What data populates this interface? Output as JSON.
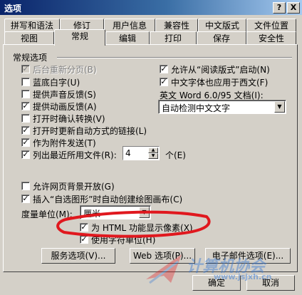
{
  "window": {
    "title": "选项",
    "help_button": "?",
    "close_button": "X"
  },
  "tabs_row1": [
    "拼写和语法",
    "修订",
    "用户信息",
    "兼容性",
    "中文版式",
    "文件位置"
  ],
  "tabs_row2": [
    "视图",
    "常规",
    "编辑",
    "打印",
    "保存",
    "安全性"
  ],
  "active_tab": "常规",
  "group_title": "常规选项",
  "left_options": [
    {
      "label": "后台重新分页(B)",
      "checked": true,
      "disabled": true
    },
    {
      "label": "蓝底白字(U)",
      "checked": false,
      "disabled": false
    },
    {
      "label": "提供声音反馈(S)",
      "checked": false,
      "disabled": false
    },
    {
      "label": "提供动画反馈(A)",
      "checked": true,
      "disabled": false
    },
    {
      "label": "打开时确认转换(V)",
      "checked": false,
      "disabled": false
    },
    {
      "label": "打开时更新自动方式的链接(L)",
      "checked": true,
      "disabled": false
    },
    {
      "label": "作为附件发送(T)",
      "checked": true,
      "disabled": false
    },
    {
      "label": "列出最近所用文件(R):",
      "checked": true,
      "disabled": false
    }
  ],
  "recent_files": {
    "value": "4",
    "suffix": "个(E)"
  },
  "right_options": [
    {
      "label": "允许从“阅读版式”启动(N)",
      "checked": true
    },
    {
      "label": "中文字体也应用于西文(F)",
      "checked": true
    }
  ],
  "english_word_label": "英文 Word 6.0/95 文档(I):",
  "english_word_value": "自动检测中文文字",
  "lower_options": [
    {
      "label": "允许网页背景开放(G)",
      "checked": false
    },
    {
      "label": "插入“自选图形”时自动创建绘图画布(C)",
      "checked": true
    }
  ],
  "measure_label": "度量单位(M):",
  "measure_value": "厘米",
  "html_pixels_option": {
    "label": "为 HTML 功能显示像素(X)",
    "checked": true
  },
  "char_units_option": {
    "label": "使用字符单位(H)",
    "checked": true
  },
  "buttons": {
    "service": "服务选项(V)...",
    "web": "Web 选项(P)...",
    "email": "电子邮件选项(E)...",
    "ok": "确定",
    "cancel": "取消"
  },
  "watermark": {
    "text": "计算机协会",
    "url": "www.jsjxh.cn",
    "color": "#3a7bd5"
  },
  "highlight_color": "#e0181e"
}
